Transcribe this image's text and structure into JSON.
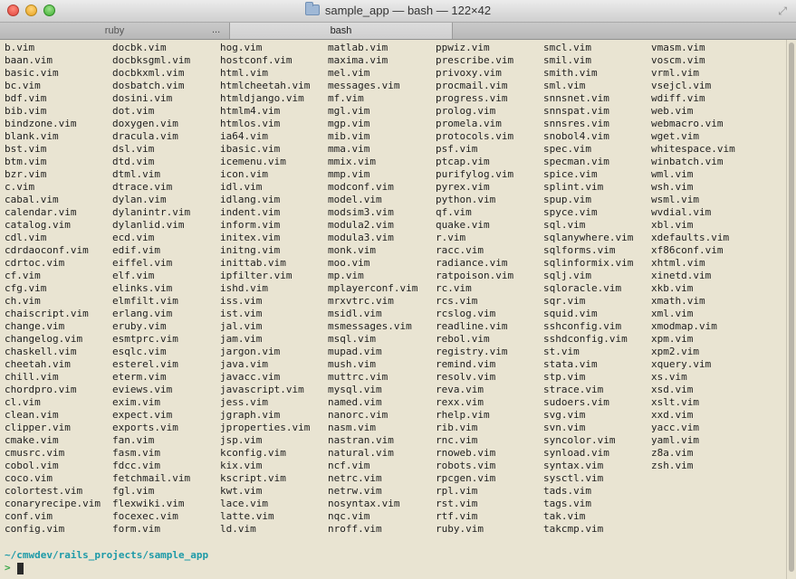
{
  "window": {
    "title": "sample_app — bash — 122×42"
  },
  "tabs": [
    {
      "label": "ruby"
    },
    {
      "label": "bash"
    }
  ],
  "tab_overflow_label": "...",
  "listing_columns": [
    [
      "b.vim",
      "baan.vim",
      "basic.vim",
      "bc.vim",
      "bdf.vim",
      "bib.vim",
      "bindzone.vim",
      "blank.vim",
      "bst.vim",
      "btm.vim",
      "bzr.vim",
      "c.vim",
      "cabal.vim",
      "calendar.vim",
      "catalog.vim",
      "cdl.vim",
      "cdrdaoconf.vim",
      "cdrtoc.vim",
      "cf.vim",
      "cfg.vim",
      "ch.vim",
      "chaiscript.vim",
      "change.vim",
      "changelog.vim",
      "chaskell.vim",
      "cheetah.vim",
      "chill.vim",
      "chordpro.vim",
      "cl.vim",
      "clean.vim",
      "clipper.vim",
      "cmake.vim",
      "cmusrc.vim",
      "cobol.vim",
      "coco.vim",
      "colortest.vim",
      "conaryrecipe.vim",
      "conf.vim",
      "config.vim"
    ],
    [
      "docbk.vim",
      "docbksgml.vim",
      "docbkxml.vim",
      "dosbatch.vim",
      "dosini.vim",
      "dot.vim",
      "doxygen.vim",
      "dracula.vim",
      "dsl.vim",
      "dtd.vim",
      "dtml.vim",
      "dtrace.vim",
      "dylan.vim",
      "dylanintr.vim",
      "dylanlid.vim",
      "ecd.vim",
      "edif.vim",
      "eiffel.vim",
      "elf.vim",
      "elinks.vim",
      "elmfilt.vim",
      "erlang.vim",
      "eruby.vim",
      "esmtprc.vim",
      "esqlc.vim",
      "esterel.vim",
      "eterm.vim",
      "eviews.vim",
      "exim.vim",
      "expect.vim",
      "exports.vim",
      "fan.vim",
      "fasm.vim",
      "fdcc.vim",
      "fetchmail.vim",
      "fgl.vim",
      "flexwiki.vim",
      "focexec.vim",
      "form.vim"
    ],
    [
      "hog.vim",
      "hostconf.vim",
      "html.vim",
      "htmlcheetah.vim",
      "htmldjango.vim",
      "htmlm4.vim",
      "htmlos.vim",
      "ia64.vim",
      "ibasic.vim",
      "icemenu.vim",
      "icon.vim",
      "idl.vim",
      "idlang.vim",
      "indent.vim",
      "inform.vim",
      "initex.vim",
      "initng.vim",
      "inittab.vim",
      "ipfilter.vim",
      "ishd.vim",
      "iss.vim",
      "ist.vim",
      "jal.vim",
      "jam.vim",
      "jargon.vim",
      "java.vim",
      "javacc.vim",
      "javascript.vim",
      "jess.vim",
      "jgraph.vim",
      "jproperties.vim",
      "jsp.vim",
      "kconfig.vim",
      "kix.vim",
      "kscript.vim",
      "kwt.vim",
      "lace.vim",
      "latte.vim",
      "ld.vim"
    ],
    [
      "matlab.vim",
      "maxima.vim",
      "mel.vim",
      "messages.vim",
      "mf.vim",
      "mgl.vim",
      "mgp.vim",
      "mib.vim",
      "mma.vim",
      "mmix.vim",
      "mmp.vim",
      "modconf.vim",
      "model.vim",
      "modsim3.vim",
      "modula2.vim",
      "modula3.vim",
      "monk.vim",
      "moo.vim",
      "mp.vim",
      "mplayerconf.vim",
      "mrxvtrc.vim",
      "msidl.vim",
      "msmessages.vim",
      "msql.vim",
      "mupad.vim",
      "mush.vim",
      "muttrc.vim",
      "mysql.vim",
      "named.vim",
      "nanorc.vim",
      "nasm.vim",
      "nastran.vim",
      "natural.vim",
      "ncf.vim",
      "netrc.vim",
      "netrw.vim",
      "nosyntax.vim",
      "nqc.vim",
      "nroff.vim"
    ],
    [
      "ppwiz.vim",
      "prescribe.vim",
      "privoxy.vim",
      "procmail.vim",
      "progress.vim",
      "prolog.vim",
      "promela.vim",
      "protocols.vim",
      "psf.vim",
      "ptcap.vim",
      "purifylog.vim",
      "pyrex.vim",
      "python.vim",
      "qf.vim",
      "quake.vim",
      "r.vim",
      "racc.vim",
      "radiance.vim",
      "ratpoison.vim",
      "rc.vim",
      "rcs.vim",
      "rcslog.vim",
      "readline.vim",
      "rebol.vim",
      "registry.vim",
      "remind.vim",
      "resolv.vim",
      "reva.vim",
      "rexx.vim",
      "rhelp.vim",
      "rib.vim",
      "rnc.vim",
      "rnoweb.vim",
      "robots.vim",
      "rpcgen.vim",
      "rpl.vim",
      "rst.vim",
      "rtf.vim",
      "ruby.vim"
    ],
    [
      "smcl.vim",
      "smil.vim",
      "smith.vim",
      "sml.vim",
      "snnsnet.vim",
      "snnspat.vim",
      "snnsres.vim",
      "snobol4.vim",
      "spec.vim",
      "specman.vim",
      "spice.vim",
      "splint.vim",
      "spup.vim",
      "spyce.vim",
      "sql.vim",
      "sqlanywhere.vim",
      "sqlforms.vim",
      "sqlinformix.vim",
      "sqlj.vim",
      "sqloracle.vim",
      "sqr.vim",
      "squid.vim",
      "sshconfig.vim",
      "sshdconfig.vim",
      "st.vim",
      "stata.vim",
      "stp.vim",
      "strace.vim",
      "sudoers.vim",
      "svg.vim",
      "svn.vim",
      "syncolor.vim",
      "synload.vim",
      "syntax.vim",
      "sysctl.vim",
      "tads.vim",
      "tags.vim",
      "tak.vim",
      "takcmp.vim"
    ],
    [
      "vmasm.vim",
      "voscm.vim",
      "vrml.vim",
      "vsejcl.vim",
      "wdiff.vim",
      "web.vim",
      "webmacro.vim",
      "wget.vim",
      "whitespace.vim",
      "winbatch.vim",
      "wml.vim",
      "wsh.vim",
      "wsml.vim",
      "wvdial.vim",
      "xbl.vim",
      "xdefaults.vim",
      "xf86conf.vim",
      "xhtml.vim",
      "xinetd.vim",
      "xkb.vim",
      "xmath.vim",
      "xml.vim",
      "xmodmap.vim",
      "xpm.vim",
      "xpm2.vim",
      "xquery.vim",
      "xs.vim",
      "xsd.vim",
      "xslt.vim",
      "xxd.vim",
      "yacc.vim",
      "yaml.vim",
      "z8a.vim",
      "zsh.vim"
    ]
  ],
  "prompt": {
    "path": "~/cmwdev/rails_projects/sample_app",
    "symbol": ">"
  }
}
